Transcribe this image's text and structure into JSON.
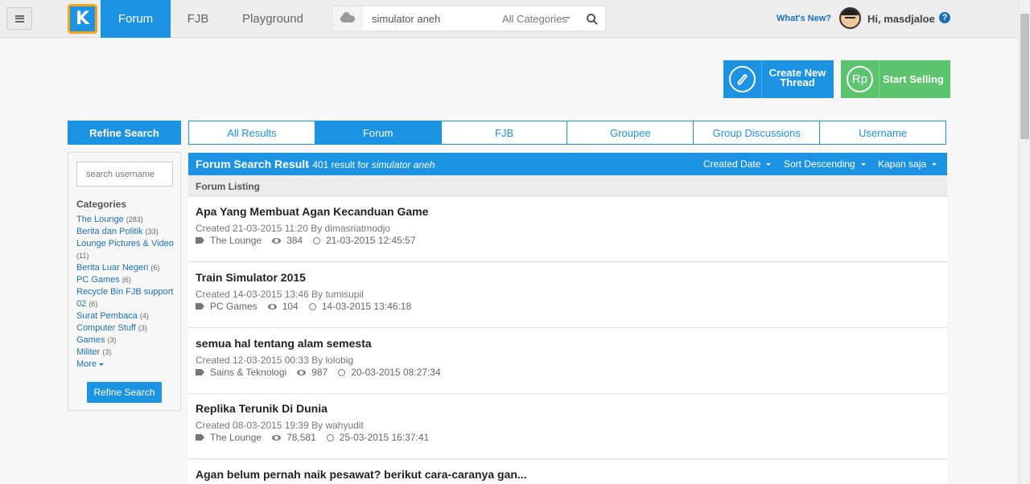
{
  "topbar": {
    "logo_text": "K",
    "nav": [
      "Forum",
      "FJB",
      "Playground"
    ],
    "search_value": "simulator aneh",
    "search_category": "All Categories",
    "whats_new": "What's New?",
    "greeting": "Hi, masdjaloe",
    "help": "?"
  },
  "actions": {
    "create_thread": "Create New Thread",
    "start_selling": "Start Selling",
    "rp_symbol": "Rp"
  },
  "sidebar": {
    "header": "Refine Search",
    "username_placeholder": "search username",
    "categories_title": "Categories",
    "categories": [
      {
        "name": "The Lounge",
        "count": "(283)"
      },
      {
        "name": "Berita dan Politik",
        "count": "(33)"
      },
      {
        "name": "Lounge Pictures & Video",
        "count": "(11)"
      },
      {
        "name": "Berita Luar Negeri",
        "count": "(6)"
      },
      {
        "name": "PC Games",
        "count": "(6)"
      },
      {
        "name": "Recycle Bin FJB support 02",
        "count": "(6)"
      },
      {
        "name": "Surat Pembaca",
        "count": "(4)"
      },
      {
        "name": "Computer Stuff",
        "count": "(3)"
      },
      {
        "name": "Games",
        "count": "(3)"
      },
      {
        "name": "Militer",
        "count": "(3)"
      }
    ],
    "more": "More",
    "refine_button": "Refine Search"
  },
  "tabs": [
    "All Results",
    "Forum",
    "FJB",
    "Groupee",
    "Group Discussions",
    "Username"
  ],
  "active_tab": "Forum",
  "results": {
    "title": "Forum Search Result",
    "count_text": "- 401 result for",
    "query": "simulator aneh",
    "sort": [
      "Created Date",
      "Sort Descending",
      "Kapan saja"
    ],
    "listing_label": "Forum Listing"
  },
  "threads": [
    {
      "title": "Apa Yang Membuat Agan Kecanduan Game",
      "meta": "Created 21-03-2015 11:20 By dimasriatmodjo",
      "category": "The Lounge",
      "views": "384",
      "last": "21-03-2015 12:45:57"
    },
    {
      "title": "Train Simulator 2015",
      "meta": "Created 14-03-2015 13:46 By tumisupil",
      "category": "PC Games",
      "views": "104",
      "last": "14-03-2015 13:46:18"
    },
    {
      "title": "semua hal tentang alam semesta",
      "meta": "Created 12-03-2015 00:33 By lolobig",
      "category": "Sains & Teknologi",
      "views": "987",
      "last": "20-03-2015 08:27:34"
    },
    {
      "title": "Replika Terunik Di Dunia",
      "meta": "Created 08-03-2015 19:39 By wahyudit",
      "category": "The Lounge",
      "views": "78,581",
      "last": "25-03-2015 16:37:41"
    },
    {
      "title": "Agan belum pernah naik pesawat? berikut cara-caranya gan...",
      "meta": "",
      "category": "",
      "views": "",
      "last": ""
    }
  ],
  "colors": {
    "primary": "#1c92e3",
    "sell": "#5cc46f",
    "logo_border": "#f4a51c"
  }
}
